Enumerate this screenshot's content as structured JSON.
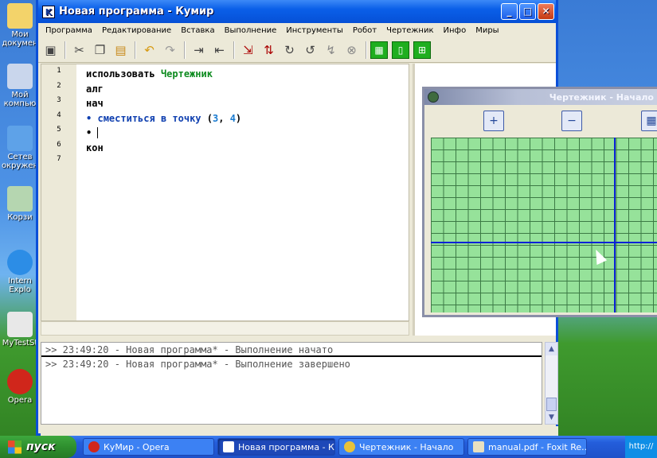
{
  "desktop": {
    "icons": [
      {
        "label": "Мои докумен"
      },
      {
        "label": "Мой компью"
      },
      {
        "label": "Сетев окружен"
      },
      {
        "label": "Корзи"
      },
      {
        "label": "Intern Explo"
      },
      {
        "label": "MyTestSt"
      },
      {
        "label": "Opera"
      }
    ]
  },
  "window": {
    "icon_letter": "K",
    "title": "Новая программа - Кумир",
    "minimize": "_",
    "maximize": "□",
    "close": "✕"
  },
  "menu": [
    "Программа",
    "Редактирование",
    "Вставка",
    "Выполнение",
    "Инструменты",
    "Робот",
    "Чертежник",
    "Инфо",
    "Миры"
  ],
  "toolbar": {
    "icons": [
      "save-icon",
      "cut-icon",
      "copy-icon",
      "paste-icon",
      "undo-icon",
      "redo-icon",
      "indent-icon",
      "outdent-icon",
      "step-in-icon",
      "step-over-icon",
      "run-icon",
      "run-step-icon",
      "step-out-icon",
      "stop-icon",
      "grid-icon",
      "frame-icon",
      "tile-icon"
    ]
  },
  "editor": {
    "line_numbers": [
      "1",
      "2",
      "3",
      "4",
      "5",
      "6",
      "7"
    ],
    "lines": {
      "l1_kw": "использовать",
      "l1_name": "Чертежник",
      "l2": "алг",
      "l3": "нач",
      "l4_bullet": "•",
      "l4_cmd": "сместиться в точку",
      "l4_open": "(",
      "l4_x": "3",
      "l4_comma": ",",
      "l4_y": "4",
      "l4_close": ")",
      "l5_bullet": "•",
      "l6": "кон"
    }
  },
  "log": {
    "lines": [
      ">> 23:49:20 - Новая программа* - Выполнение начато",
      ">> 23:49:20 - Новая программа* - Выполнение завершено"
    ]
  },
  "drawer": {
    "title": "Чертежник - Начало",
    "zoom_in": "+",
    "zoom_out": "−",
    "grid_toggle": "▦"
  },
  "taskbar": {
    "start_label": "пуск",
    "tasks": [
      {
        "label": "КуМир - Opera",
        "color": "#d0261b"
      },
      {
        "label": "Новая программа - К...",
        "color": "#ffffff"
      },
      {
        "label": "Чертежник - Начало",
        "color": "#e8c23a"
      },
      {
        "label": "manual.pdf - Foxit Re...",
        "color": "#e8e0c0"
      }
    ],
    "tray_text": "http://"
  }
}
